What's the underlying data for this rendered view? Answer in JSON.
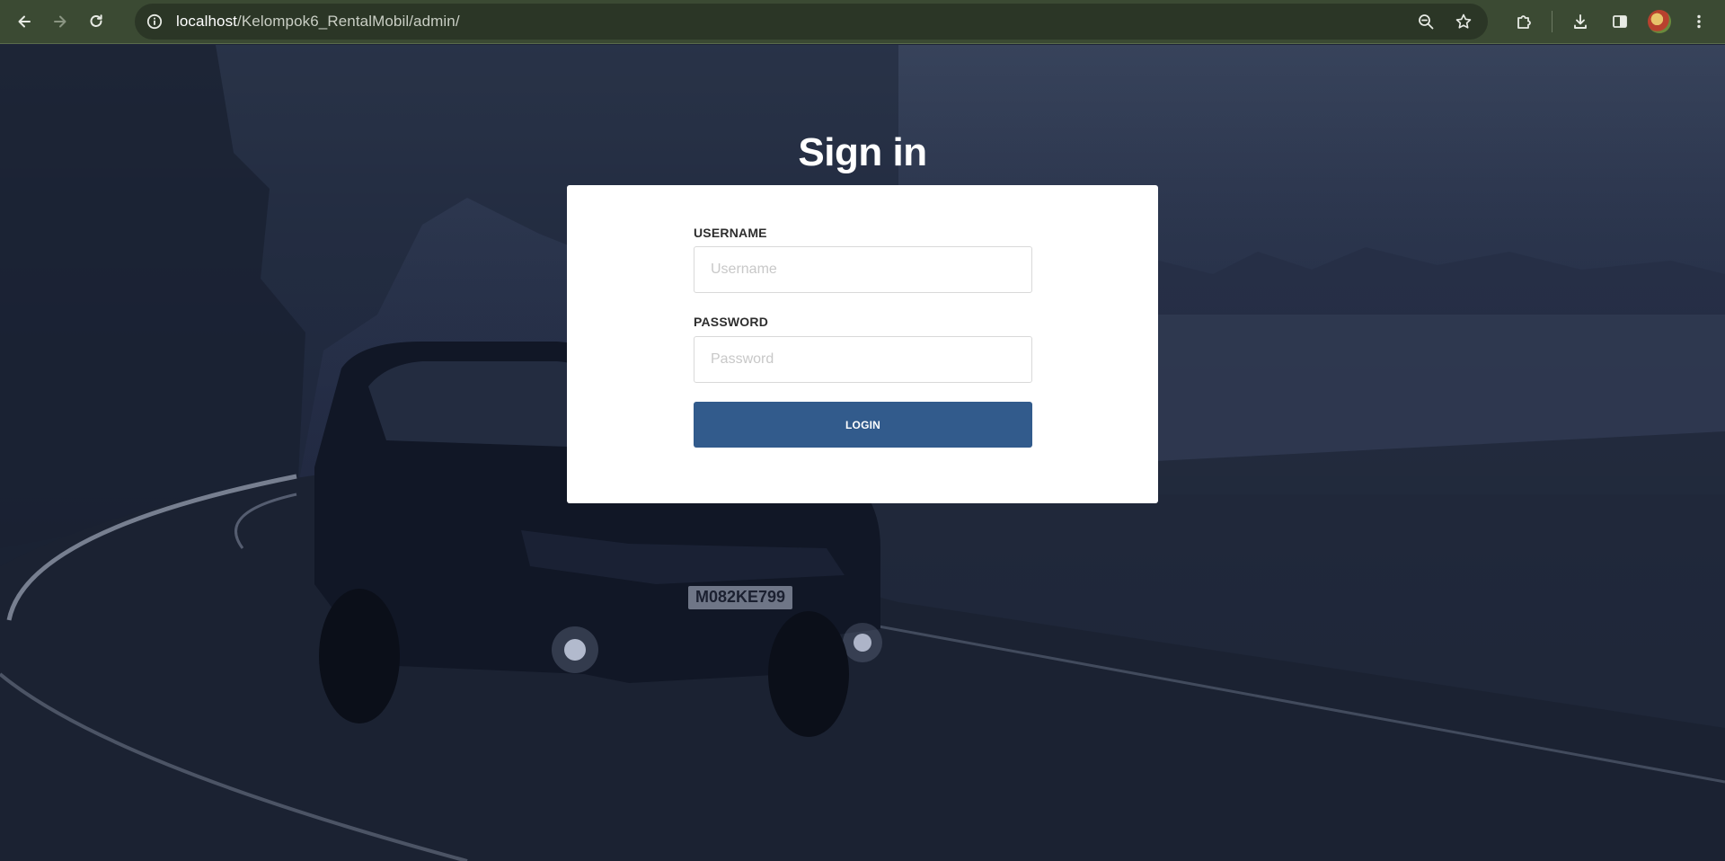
{
  "browser": {
    "url_host": "localhost",
    "url_path": "/Kelompok6_RentalMobil/admin/",
    "icons": {
      "back": "back-arrow-icon",
      "forward": "forward-arrow-icon",
      "reload": "reload-icon",
      "site_info": "info-icon",
      "zoom": "zoom-out-icon",
      "bookmark": "star-icon",
      "extensions": "puzzle-icon",
      "downloads": "download-icon",
      "side_panel": "side-panel-icon",
      "profile": "avatar",
      "menu": "kebab-menu-icon"
    }
  },
  "login": {
    "title": "Sign in",
    "username_label": "USERNAME",
    "username_placeholder": "Username",
    "password_label": "PASSWORD",
    "password_placeholder": "Password",
    "button_label": "LOGIN"
  },
  "background": {
    "plate_text": "M082KE799"
  },
  "colors": {
    "chrome_bg": "#3b4a33",
    "page_overlay": "#222a40",
    "button": "#325b8c",
    "card": "#ffffff"
  }
}
